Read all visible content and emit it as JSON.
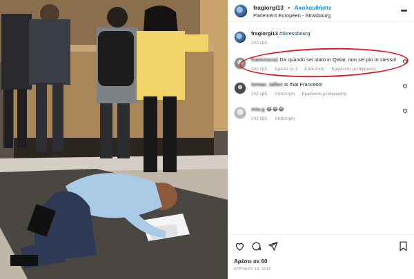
{
  "header": {
    "username": "fragiorgi13",
    "separator": "•",
    "follow_label": "Ακολουθήστε",
    "location": "Parlement Européen - Strasbourg",
    "more_icon": "more-dots-icon"
  },
  "caption": {
    "username": "fragiorgi13",
    "hashtag": "#Stressbourg",
    "time": "242 εβδ."
  },
  "comments": [
    {
      "username": "francescoz",
      "text": "Da quando sei stato in Qatar, non sei più lo stesso!",
      "time": "242 εβδ.",
      "likes": "Αρέσει σε 2",
      "reply": "Απάντηση",
      "translate": "Εμφάνιση μετάφρασης"
    },
    {
      "username": "tomas_tallen",
      "text": "Is that Franceso!",
      "time": "242 εβδ.",
      "reply": "Απάντηση",
      "translate": "Εμφάνιση μετάφρασης"
    },
    {
      "username": "mia.g",
      "text": "😂😂😂",
      "time": "242 εβδ.",
      "reply": "Απάντηση"
    }
  ],
  "actions": {
    "icons": [
      "heart-icon",
      "comment-icon",
      "share-icon",
      "bookmark-icon"
    ],
    "likes": "Αρέσει σε 60",
    "date": "ΑΠΡΙΛΙΟΥ 18, 2018"
  },
  "colors": {
    "accent": "#0095f6",
    "highlight": "#e01b24",
    "muted": "#8e8e8e"
  }
}
